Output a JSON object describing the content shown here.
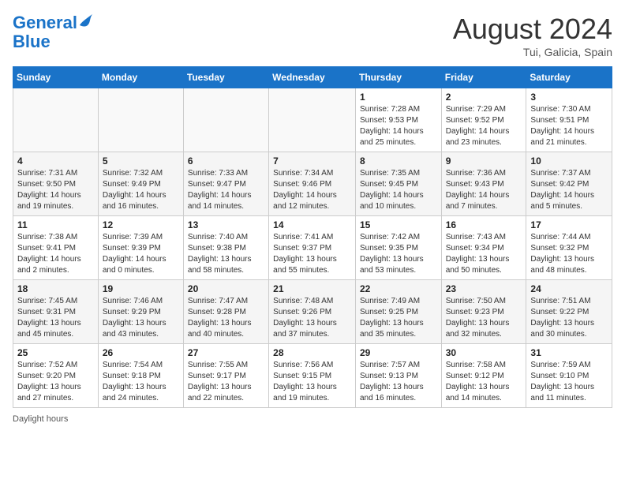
{
  "header": {
    "logo_line1": "General",
    "logo_line2": "Blue",
    "month_title": "August 2024",
    "subtitle": "Tui, Galicia, Spain"
  },
  "days_of_week": [
    "Sunday",
    "Monday",
    "Tuesday",
    "Wednesday",
    "Thursday",
    "Friday",
    "Saturday"
  ],
  "weeks": [
    [
      {
        "day": "",
        "info": ""
      },
      {
        "day": "",
        "info": ""
      },
      {
        "day": "",
        "info": ""
      },
      {
        "day": "",
        "info": ""
      },
      {
        "day": "1",
        "info": "Sunrise: 7:28 AM\nSunset: 9:53 PM\nDaylight: 14 hours and 25 minutes."
      },
      {
        "day": "2",
        "info": "Sunrise: 7:29 AM\nSunset: 9:52 PM\nDaylight: 14 hours and 23 minutes."
      },
      {
        "day": "3",
        "info": "Sunrise: 7:30 AM\nSunset: 9:51 PM\nDaylight: 14 hours and 21 minutes."
      }
    ],
    [
      {
        "day": "4",
        "info": "Sunrise: 7:31 AM\nSunset: 9:50 PM\nDaylight: 14 hours and 19 minutes."
      },
      {
        "day": "5",
        "info": "Sunrise: 7:32 AM\nSunset: 9:49 PM\nDaylight: 14 hours and 16 minutes."
      },
      {
        "day": "6",
        "info": "Sunrise: 7:33 AM\nSunset: 9:47 PM\nDaylight: 14 hours and 14 minutes."
      },
      {
        "day": "7",
        "info": "Sunrise: 7:34 AM\nSunset: 9:46 PM\nDaylight: 14 hours and 12 minutes."
      },
      {
        "day": "8",
        "info": "Sunrise: 7:35 AM\nSunset: 9:45 PM\nDaylight: 14 hours and 10 minutes."
      },
      {
        "day": "9",
        "info": "Sunrise: 7:36 AM\nSunset: 9:43 PM\nDaylight: 14 hours and 7 minutes."
      },
      {
        "day": "10",
        "info": "Sunrise: 7:37 AM\nSunset: 9:42 PM\nDaylight: 14 hours and 5 minutes."
      }
    ],
    [
      {
        "day": "11",
        "info": "Sunrise: 7:38 AM\nSunset: 9:41 PM\nDaylight: 14 hours and 2 minutes."
      },
      {
        "day": "12",
        "info": "Sunrise: 7:39 AM\nSunset: 9:39 PM\nDaylight: 14 hours and 0 minutes."
      },
      {
        "day": "13",
        "info": "Sunrise: 7:40 AM\nSunset: 9:38 PM\nDaylight: 13 hours and 58 minutes."
      },
      {
        "day": "14",
        "info": "Sunrise: 7:41 AM\nSunset: 9:37 PM\nDaylight: 13 hours and 55 minutes."
      },
      {
        "day": "15",
        "info": "Sunrise: 7:42 AM\nSunset: 9:35 PM\nDaylight: 13 hours and 53 minutes."
      },
      {
        "day": "16",
        "info": "Sunrise: 7:43 AM\nSunset: 9:34 PM\nDaylight: 13 hours and 50 minutes."
      },
      {
        "day": "17",
        "info": "Sunrise: 7:44 AM\nSunset: 9:32 PM\nDaylight: 13 hours and 48 minutes."
      }
    ],
    [
      {
        "day": "18",
        "info": "Sunrise: 7:45 AM\nSunset: 9:31 PM\nDaylight: 13 hours and 45 minutes."
      },
      {
        "day": "19",
        "info": "Sunrise: 7:46 AM\nSunset: 9:29 PM\nDaylight: 13 hours and 43 minutes."
      },
      {
        "day": "20",
        "info": "Sunrise: 7:47 AM\nSunset: 9:28 PM\nDaylight: 13 hours and 40 minutes."
      },
      {
        "day": "21",
        "info": "Sunrise: 7:48 AM\nSunset: 9:26 PM\nDaylight: 13 hours and 37 minutes."
      },
      {
        "day": "22",
        "info": "Sunrise: 7:49 AM\nSunset: 9:25 PM\nDaylight: 13 hours and 35 minutes."
      },
      {
        "day": "23",
        "info": "Sunrise: 7:50 AM\nSunset: 9:23 PM\nDaylight: 13 hours and 32 minutes."
      },
      {
        "day": "24",
        "info": "Sunrise: 7:51 AM\nSunset: 9:22 PM\nDaylight: 13 hours and 30 minutes."
      }
    ],
    [
      {
        "day": "25",
        "info": "Sunrise: 7:52 AM\nSunset: 9:20 PM\nDaylight: 13 hours and 27 minutes."
      },
      {
        "day": "26",
        "info": "Sunrise: 7:54 AM\nSunset: 9:18 PM\nDaylight: 13 hours and 24 minutes."
      },
      {
        "day": "27",
        "info": "Sunrise: 7:55 AM\nSunset: 9:17 PM\nDaylight: 13 hours and 22 minutes."
      },
      {
        "day": "28",
        "info": "Sunrise: 7:56 AM\nSunset: 9:15 PM\nDaylight: 13 hours and 19 minutes."
      },
      {
        "day": "29",
        "info": "Sunrise: 7:57 AM\nSunset: 9:13 PM\nDaylight: 13 hours and 16 minutes."
      },
      {
        "day": "30",
        "info": "Sunrise: 7:58 AM\nSunset: 9:12 PM\nDaylight: 13 hours and 14 minutes."
      },
      {
        "day": "31",
        "info": "Sunrise: 7:59 AM\nSunset: 9:10 PM\nDaylight: 13 hours and 11 minutes."
      }
    ]
  ],
  "footer": {
    "daylight_label": "Daylight hours"
  }
}
